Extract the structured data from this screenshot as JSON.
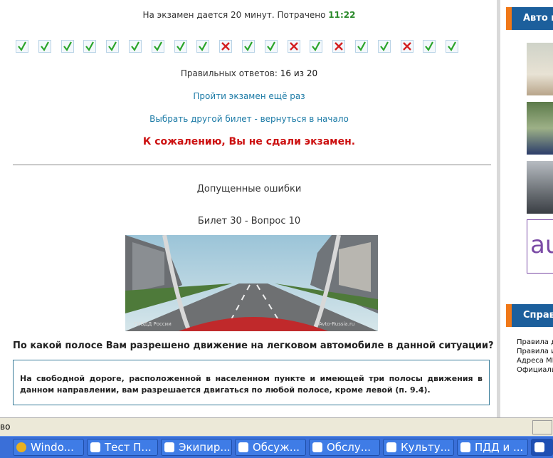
{
  "exam": {
    "timer_prefix": "На экзамен дается 20 минут. Потрачено ",
    "timer_value": "11:22",
    "answers": [
      true,
      true,
      true,
      true,
      true,
      true,
      true,
      true,
      true,
      false,
      true,
      true,
      false,
      true,
      false,
      true,
      true,
      false,
      true,
      true
    ],
    "score_label": "Правильных ответов: ",
    "score_value": "16 из 20",
    "retry_link": "Пройти экзамен ещё раз",
    "other_ticket_link": "Выбрать другой билет - вернуться в начало",
    "fail_message": "К сожалению, Вы не сдали экзамен.",
    "errors_title": "Допущенные ошибки",
    "ticket_label": "Билет 30 - Вопрос 10",
    "photo_watermark_left": "ГИБДД России",
    "photo_watermark_right": "Avto-Russia.ru",
    "question": "По какой полосе Вам разрешено движение на легковом автомобиле в данной ситуации?",
    "explanation": "На свободной дороге, расположенной в населенном пункте и имеющей три полосы движения в данном направлении, вам разрешается двигаться по любой полосе, кроме левой (п. 9.4)."
  },
  "sidebar": {
    "header1": "Авто но",
    "header2": "Справо",
    "ad_text": "au",
    "links": [
      "Правила д",
      "Правила и",
      "Адреса МР",
      "Официаль"
    ]
  },
  "statusbar": {
    "text": "во"
  },
  "taskbar": {
    "items": [
      {
        "label": "Windo...",
        "icon": "media-player-icon"
      },
      {
        "label": "Тест П...",
        "icon": "ie-icon"
      },
      {
        "label": "Экипир...",
        "icon": "ie-icon"
      },
      {
        "label": "Обсуж...",
        "icon": "ie-icon"
      },
      {
        "label": "Обслу...",
        "icon": "ie-icon"
      },
      {
        "label": "Культу...",
        "icon": "ie-icon"
      },
      {
        "label": "ПДД и ...",
        "icon": "ie-icon"
      },
      {
        "label": "",
        "icon": "ie-icon"
      }
    ]
  },
  "colors": {
    "correct": "#2aa52a",
    "wrong": "#d42020",
    "link": "#1b7aa6",
    "fail": "#cc1111",
    "sidebar_header": "#1c5f9c",
    "sidebar_accent": "#f07818"
  }
}
